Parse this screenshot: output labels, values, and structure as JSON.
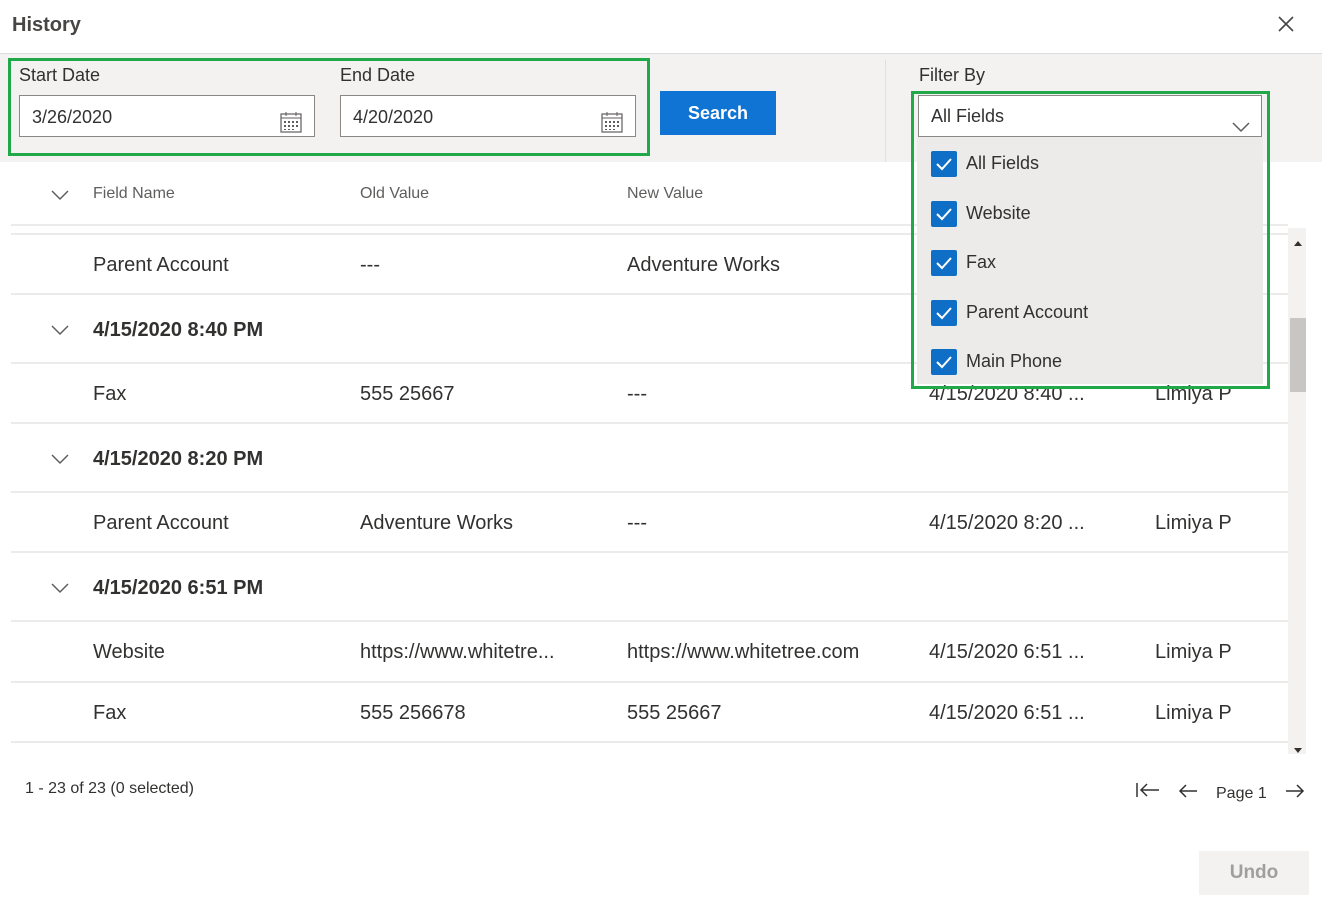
{
  "dialog": {
    "title": "History"
  },
  "filters": {
    "start_label": "Start Date",
    "start_value": "3/26/2020",
    "end_label": "End Date",
    "end_value": "4/20/2020",
    "search_label": "Search",
    "filter_label": "Filter By",
    "filter_selected": "All Fields",
    "options": [
      {
        "label": "All Fields",
        "checked": true
      },
      {
        "label": "Website",
        "checked": true
      },
      {
        "label": "Fax",
        "checked": true
      },
      {
        "label": "Parent Account",
        "checked": true
      },
      {
        "label": "Main Phone",
        "checked": true
      }
    ]
  },
  "table": {
    "columns": [
      "Field Name",
      "Old Value",
      "New Value"
    ],
    "row0": {
      "field": "Parent Account",
      "old": "---",
      "new": "Adventure Works"
    },
    "group1": "4/15/2020 8:40 PM",
    "row1": {
      "field": "Fax",
      "old": "555 25667",
      "new": "---",
      "changed": "4/15/2020 8:40 ...",
      "by": "Limiya P"
    },
    "group2": "4/15/2020 8:20 PM",
    "row2": {
      "field": "Parent Account",
      "old": "Adventure Works",
      "new": "---",
      "changed": "4/15/2020 8:20 ...",
      "by": "Limiya P"
    },
    "group3": "4/15/2020 6:51 PM",
    "row3": {
      "field": "Website",
      "old": "https://www.whitetre...",
      "new": "https://www.whitetree.com",
      "changed": "4/15/2020 6:51 ...",
      "by": "Limiya P"
    },
    "row4": {
      "field": "Fax",
      "old": "555 256678",
      "new": "555 25667",
      "changed": "4/15/2020 6:51 ...",
      "by": "Limiya P"
    }
  },
  "footer": {
    "count_text": "1 - 23 of 23 (0 selected)",
    "page_text": "Page 1",
    "undo_label": "Undo"
  },
  "colors": {
    "accent": "#0f74d4",
    "highlight": "#21a849"
  },
  "icons": [
    "close-icon",
    "calendar-icon",
    "chevron-down-icon",
    "checkbox-icon",
    "first-page-icon",
    "previous-page-icon",
    "next-page-icon"
  ]
}
